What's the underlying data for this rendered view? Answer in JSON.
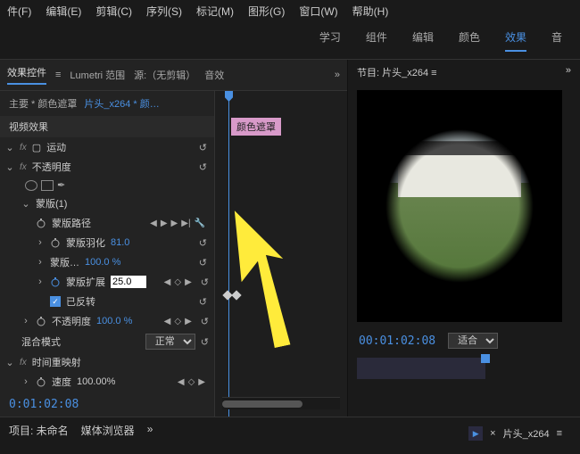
{
  "menubar": [
    "件(F)",
    "编辑(E)",
    "剪辑(C)",
    "序列(S)",
    "标记(M)",
    "图形(G)",
    "窗口(W)",
    "帮助(H)"
  ],
  "workspace_tabs": [
    "学习",
    "组件",
    "编辑",
    "颜色",
    "效果",
    "音"
  ],
  "workspace_active": 4,
  "panel_tabs": {
    "effect_controls": "效果控件",
    "lumetri": "Lumetri 范围",
    "source": "源:（无剪辑）",
    "audio": "音效",
    "menu": "»"
  },
  "crumb": {
    "master": "主要 * 颜色遮罩",
    "clip": "片头_x264 * 颜…"
  },
  "section": {
    "video_fx": "视频效果"
  },
  "clip_label": "颜色遮罩",
  "props": {
    "motion": "运动",
    "opacity": "不透明度",
    "mask": "蒙版(1)",
    "mask_path": "蒙版路径",
    "mask_feather": {
      "label": "蒙版羽化",
      "val": "81.0"
    },
    "mask_opacity": {
      "label": "蒙版…",
      "val": "100.0 %"
    },
    "mask_expansion": {
      "label": "蒙版扩展",
      "val": "25.0"
    },
    "inverted": {
      "label": "已反转"
    },
    "opacity2": {
      "label": "不透明度",
      "val": "100.0 %"
    },
    "blend": {
      "label": "混合模式",
      "val": "正常"
    },
    "time_remap": "时间重映射",
    "speed": {
      "label": "速度",
      "val": "100.00%"
    }
  },
  "timecode_left": "0:01:02:08",
  "bottom": {
    "project": "项目: 未命名",
    "media_browser": "媒体浏览器"
  },
  "program": {
    "title": "节目: 片头_x264",
    "menu": "»",
    "timecode": "00:01:02:08",
    "fit": "适合"
  },
  "timeline_clip": {
    "close": "×",
    "name": "片头_x264"
  }
}
